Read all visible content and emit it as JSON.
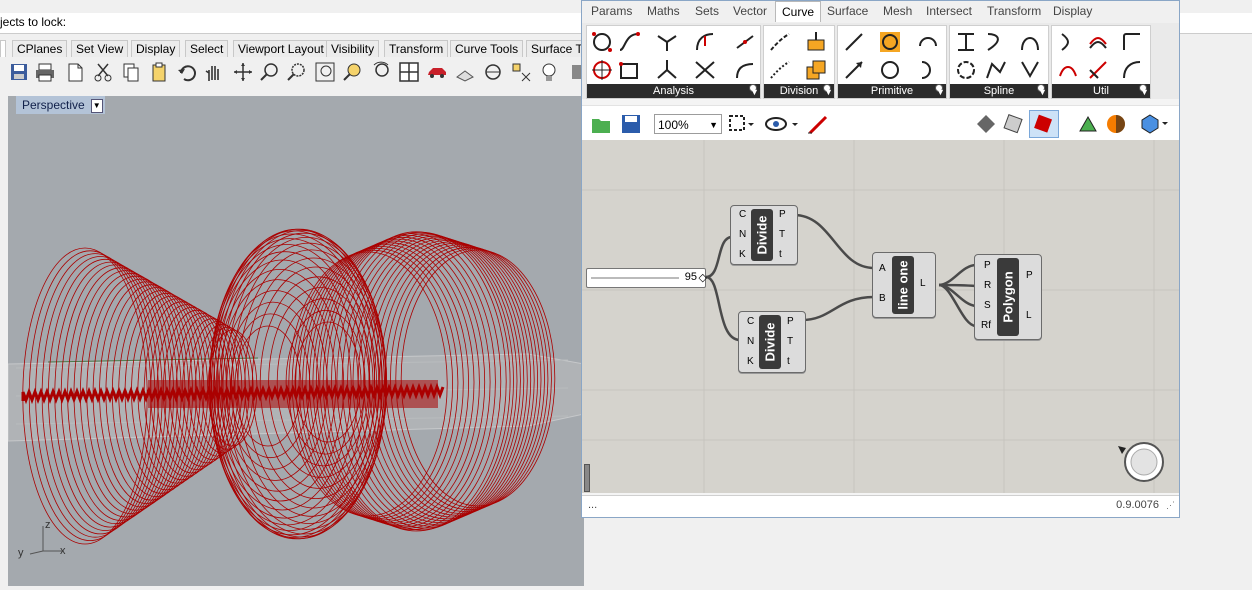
{
  "rhino": {
    "command_prompt": "jects to lock:",
    "tabs": [
      "CPlanes",
      "Set View",
      "Display",
      "Select",
      "Viewport Layout",
      "Visibility",
      "Transform",
      "Curve Tools",
      "Surface To"
    ],
    "toolbar_icons": [
      "save-icon",
      "print-icon",
      "new-icon",
      "cut-icon",
      "copy-icon",
      "paste-icon",
      "undo-icon",
      "pan-hand-icon",
      "rotate-icon",
      "zoom-icon",
      "zoom-window-icon",
      "zoom-extents-icon",
      "zoom-selected-icon",
      "zoom-dynamic-icon",
      "four-view-icon",
      "car-icon",
      "hide-icon",
      "lock-icon",
      "snap-icon",
      "light-icon",
      "render-icon"
    ],
    "viewport": {
      "label": "Perspective",
      "axis_labels": {
        "z": "z",
        "y": "y",
        "x": "x"
      }
    }
  },
  "grasshopper": {
    "tabs": [
      "Params",
      "Maths",
      "Sets",
      "Vector",
      "Curve",
      "Surface",
      "Mesh",
      "Intersect",
      "Transform",
      "Display"
    ],
    "active_tab": "Curve",
    "groups": [
      "Analysis",
      "Division",
      "Primitive",
      "Spline",
      "Util"
    ],
    "zoom": "100%",
    "status": {
      "left": "...",
      "version": "0.9.0076"
    },
    "slider_value": "95",
    "components": {
      "divide1": {
        "name": "Divide",
        "inputs": [
          "C",
          "N",
          "K"
        ],
        "outputs": [
          "P",
          "T",
          "t"
        ]
      },
      "divide2": {
        "name": "Divide",
        "inputs": [
          "C",
          "N",
          "K"
        ],
        "outputs": [
          "P",
          "T",
          "t"
        ]
      },
      "line": {
        "name": "line one",
        "inputs": [
          "A",
          "B"
        ],
        "outputs": [
          "L"
        ]
      },
      "polygon": {
        "name": "Polygon",
        "inputs": [
          "P",
          "R",
          "S",
          "Rf"
        ],
        "outputs": [
          "P",
          "L"
        ]
      }
    }
  },
  "colors": {
    "geometry": "#aa0000",
    "accent": "#3a3a3a",
    "viewport_bg": "#a4a9ae",
    "canvas_bg": "#d5d3cd"
  }
}
